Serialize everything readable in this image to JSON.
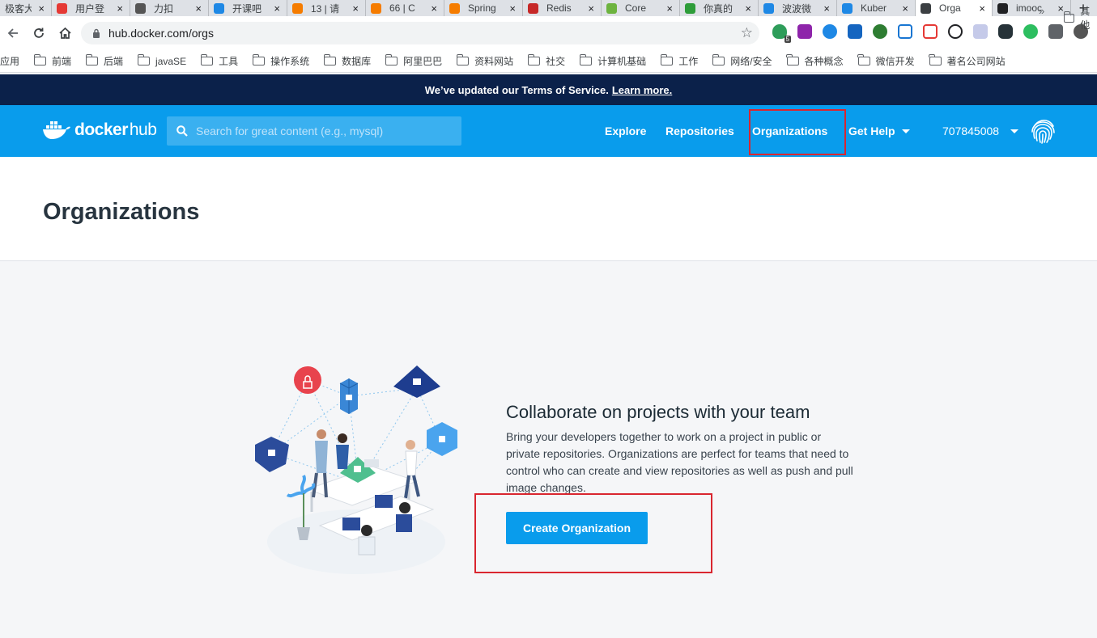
{
  "browser": {
    "tabs": [
      {
        "title": "极客大",
        "color": "#c0392b",
        "active": false
      },
      {
        "title": "用户登",
        "color": "#e53935",
        "active": false
      },
      {
        "title": "力扣",
        "color": "#555555",
        "active": false
      },
      {
        "title": "开课吧",
        "color": "#1e88e5",
        "active": false
      },
      {
        "title": "13 | 请",
        "color": "#f57c00",
        "active": false
      },
      {
        "title": "66 | C",
        "color": "#f57c00",
        "active": false
      },
      {
        "title": "Spring",
        "color": "#f57c00",
        "active": false
      },
      {
        "title": "Redis",
        "color": "#c62828",
        "active": false
      },
      {
        "title": "Core",
        "color": "#6db33f",
        "active": false
      },
      {
        "title": "你真的",
        "color": "#2e9d3a",
        "active": false
      },
      {
        "title": "波波微",
        "color": "#1e88e5",
        "active": false
      },
      {
        "title": "Kuber",
        "color": "#1e88e5",
        "active": false
      },
      {
        "title": "Orga",
        "color": "#3c4043",
        "active": true
      },
      {
        "title": "imooc",
        "color": "#202124",
        "active": false
      }
    ],
    "new_tab": "+",
    "close_glyph": "×",
    "url": "hub.docker.com/orgs",
    "extension_badge": "5",
    "bookmarks": [
      {
        "label": "应用",
        "folder": false
      },
      {
        "label": "前端",
        "folder": true
      },
      {
        "label": "后端",
        "folder": true
      },
      {
        "label": "javaSE",
        "folder": true
      },
      {
        "label": "工具",
        "folder": true
      },
      {
        "label": "操作系统",
        "folder": true
      },
      {
        "label": "数据库",
        "folder": true
      },
      {
        "label": "阿里巴巴",
        "folder": true
      },
      {
        "label": "资料网站",
        "folder": true
      },
      {
        "label": "社交",
        "folder": true
      },
      {
        "label": "计算机基础",
        "folder": true
      },
      {
        "label": "工作",
        "folder": true
      },
      {
        "label": "网络/安全",
        "folder": true
      },
      {
        "label": "各种概念",
        "folder": true
      },
      {
        "label": "微信开发",
        "folder": true
      },
      {
        "label": "著名公司网站",
        "folder": true
      }
    ],
    "bookmarks_more": "»",
    "bookmarks_other": "其他"
  },
  "banner": {
    "text": "We’ve updated our Terms of Service.",
    "link": "Learn more."
  },
  "header": {
    "logo_docker": "docker",
    "logo_hub": "hub",
    "search_placeholder": "Search for great content (e.g., mysql)",
    "nav": {
      "explore": "Explore",
      "repositories": "Repositories",
      "organizations": "Organizations",
      "get_help": "Get Help"
    },
    "username": "707845008",
    "brand_color": "#099cec"
  },
  "page": {
    "title": "Organizations",
    "empty_title": "Collaborate on projects with your team",
    "empty_desc": "Bring your developers together to work on a project in public or private repositories. Organizations are perfect for teams that need to control who can create and view repositories as well as push and pull image changes.",
    "create_button": "Create Organization",
    "highlight_color": "#d9262f"
  }
}
